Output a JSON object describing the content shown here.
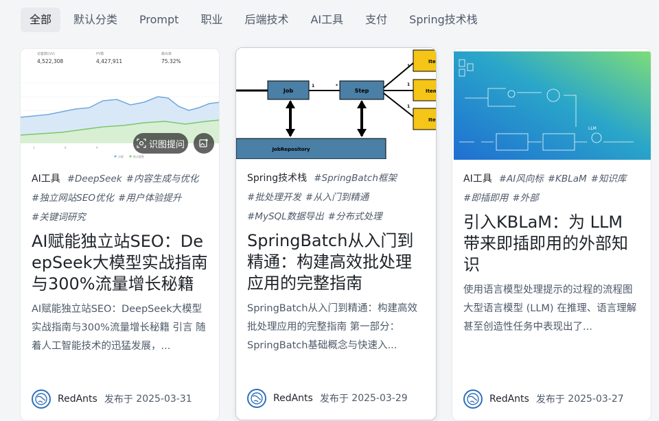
{
  "tabs": [
    {
      "label": "全部",
      "active": true
    },
    {
      "label": "默认分类"
    },
    {
      "label": "Prompt"
    },
    {
      "label": "职业"
    },
    {
      "label": "后端技术"
    },
    {
      "label": "AI工具"
    },
    {
      "label": "支付"
    },
    {
      "label": "Spring技术栈"
    }
  ],
  "cards": [
    {
      "category": "AI工具",
      "tags": [
        "#DeepSeek",
        "#内容生成与优化",
        "#独立网站SEO优化",
        "#用户体验提升",
        "#关键词研究"
      ],
      "title": "AI赋能独立站SEO：DeepSeek大模型实战指南与300%流量增长秘籍",
      "desc": "AI赋能独立站SEO：DeepSeek大模型实战指南与300%流量增长秘籍 引言 随着人工智能技术的迅猛发展，...",
      "author": "RedAnts",
      "date_prefix": "发布于",
      "date": "2025-03-31",
      "thumb": {
        "stats": [
          {
            "label": "访客数(UV)",
            "value": "4,522,308"
          },
          {
            "label": "PV数",
            "value": "4,427,911"
          },
          {
            "label": "跳出率",
            "value": "75.32%"
          }
        ],
        "legend": [
          "访客",
          "新访客数"
        ],
        "ocr_label": "识图提问"
      }
    },
    {
      "category": "Spring技术栈",
      "tags": [
        "#SpringBatch框架",
        "#批处理开发",
        "#从入门到精通",
        "#MySQL数据导出",
        "#分布式处理"
      ],
      "title": "SpringBatch从入门到精通：构建高效批处理应用的完整指南",
      "desc": "SpringBatch从入门到精通：构建高效批处理应用的完整指南 第一部分：SpringBatch基础概念与快速入...",
      "author": "RedAnts",
      "date_prefix": "发布于",
      "date": "2025-03-29",
      "thumb": {
        "job": "Job",
        "step": "Step",
        "repo": "JobRepository",
        "item1": "Ite",
        "item2": "Item",
        "item3": "Ite"
      }
    },
    {
      "category": "AI工具",
      "tags": [
        "#AI风向标",
        "#KBLaM",
        "#知识库",
        "#即插即用",
        "#外部"
      ],
      "title": "引入KBLaM：为 LLM 带来即插即用的外部知识",
      "desc": "使用语言模型处理提示的过程的流程图 大型语言模型 (LLM) 在推理、语言理解甚至创造性任务中表现出了...",
      "author": "RedAnts",
      "date_prefix": "发布于",
      "date": "2025-03-27",
      "thumb": {
        "llm_label": "LLM"
      }
    }
  ],
  "colors": {
    "accent": "#2f6fb8",
    "active_tab_bg": "#e9eaed",
    "batch_box": "#4a7fa6",
    "item_box": "#f5c518"
  }
}
